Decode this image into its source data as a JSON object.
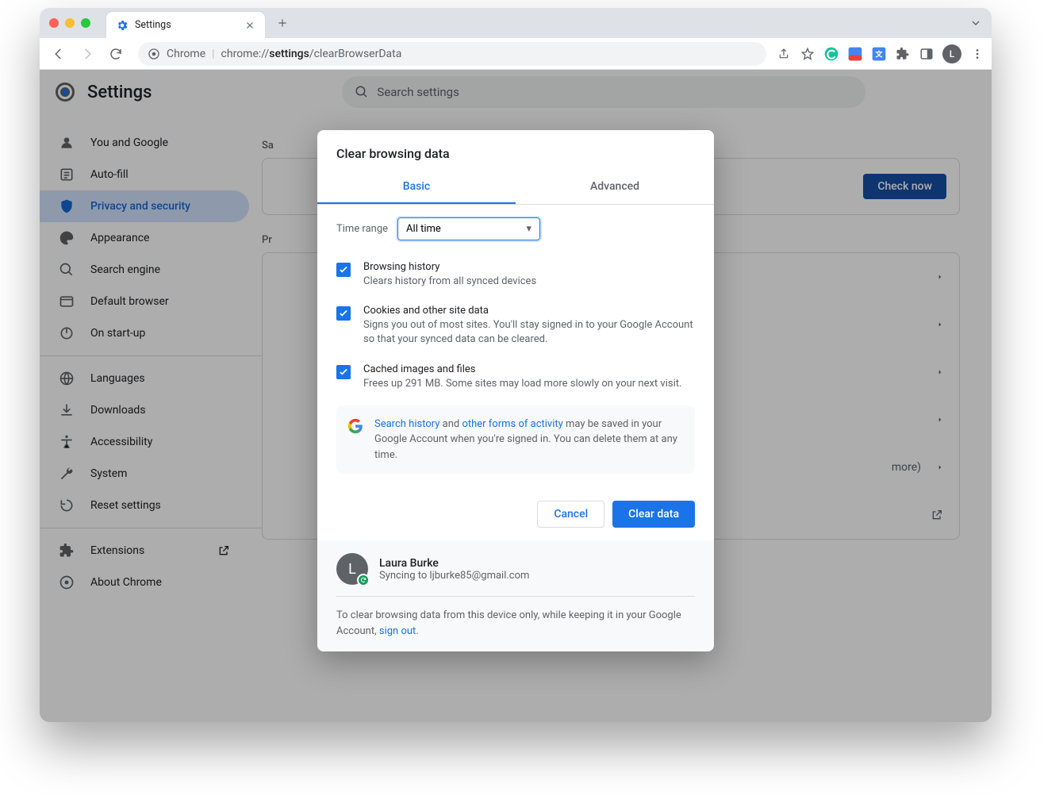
{
  "window": {
    "tab_title": "Settings",
    "url_prefix": "Chrome",
    "url_path_pre": "chrome://",
    "url_path_bold": "settings",
    "url_path_post": "/clearBrowserData",
    "avatar_letter": "L"
  },
  "settings": {
    "title": "Settings",
    "search_placeholder": "Search settings",
    "sidebar": [
      {
        "label": "You and Google"
      },
      {
        "label": "Auto-fill"
      },
      {
        "label": "Privacy and security"
      },
      {
        "label": "Appearance"
      },
      {
        "label": "Search engine"
      },
      {
        "label": "Default browser"
      },
      {
        "label": "On start-up"
      },
      {
        "label": "Languages"
      },
      {
        "label": "Downloads"
      },
      {
        "label": "Accessibility"
      },
      {
        "label": "System"
      },
      {
        "label": "Reset settings"
      },
      {
        "label": "Extensions"
      },
      {
        "label": "About Chrome"
      }
    ],
    "section_safety": "Sa",
    "check_now": "Check now",
    "section_privacy": "Pr",
    "more_text": "more)"
  },
  "modal": {
    "title": "Clear browsing data",
    "tabs": {
      "basic": "Basic",
      "advanced": "Advanced"
    },
    "time_range_label": "Time range",
    "time_range_value": "All time",
    "items": [
      {
        "title": "Browsing history",
        "desc": "Clears history from all synced devices"
      },
      {
        "title": "Cookies and other site data",
        "desc": "Signs you out of most sites. You'll stay signed in to your Google Account so that your synced data can be cleared."
      },
      {
        "title": "Cached images and files",
        "desc": "Frees up 291 MB. Some sites may load more slowly on your next visit."
      }
    ],
    "info_link1": "Search history",
    "info_text1": " and ",
    "info_link2": "other forms of activity",
    "info_text2": " may be saved in your Google Account when you're signed in. You can delete them at any time.",
    "cancel": "Cancel",
    "clear": "Clear data",
    "user_name": "Laura Burke",
    "user_sync": "Syncing to ljburke85@gmail.com",
    "user_letter": "L",
    "footer_text_pre": "To clear browsing data from this device only, while keeping it in your Google Account, ",
    "footer_link": "sign out",
    "footer_text_post": "."
  }
}
